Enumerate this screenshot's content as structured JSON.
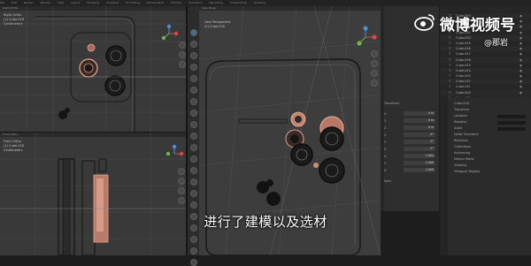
{
  "menubar": {
    "items": [
      "File",
      "Edit",
      "Render",
      "Window",
      "Help",
      "Layout",
      "Modeling",
      "Sculpting",
      "UV Editing",
      "Texture Paint",
      "Shading",
      "Animation",
      "Rendering",
      "Compositing",
      "Scripting"
    ]
  },
  "viewports": {
    "top_left": {
      "label": "Right Ortho",
      "info": [
        "Right Ortho",
        "(1) Cube.018",
        "Centimeters"
      ]
    },
    "bottom_left": {
      "label": "Front Ortho",
      "info": [
        "Front Ortho",
        "(1) Cube.018",
        "Centimeters"
      ]
    },
    "center": {
      "label": "User Persp",
      "info": [
        "User Perspective",
        "(1) Cube.018"
      ]
    }
  },
  "outliner": {
    "rows": [
      "Cube.054",
      "Cube.053",
      "Cube.052",
      "Cube.051",
      "Cube.050",
      "Cube.049",
      "Cube.048",
      "Cube.047",
      "Cube.046",
      "Cube.045",
      "Cube.044",
      "Cube.043",
      "Cube.042",
      "Cube.041",
      "Cube.040",
      "Cube.039"
    ]
  },
  "npanel": {
    "sections": [
      "Transform",
      "Item"
    ],
    "rows": [
      {
        "label": "X",
        "value": "0 m"
      },
      {
        "label": "Y",
        "value": "0 m"
      },
      {
        "label": "Z",
        "value": "0 m"
      },
      {
        "label": "X",
        "value": "0°"
      },
      {
        "label": "Y",
        "value": "0°"
      },
      {
        "label": "Z",
        "value": "0°"
      },
      {
        "label": "X",
        "value": "1.000"
      },
      {
        "label": "Y",
        "value": "1.000"
      },
      {
        "label": "Z",
        "value": "1.000"
      }
    ]
  },
  "properties": {
    "rows": [
      "Cube.018",
      "Transform",
      "Location",
      "Rotation",
      "Scale",
      "Delta Transform",
      "Relations",
      "Collections",
      "Instancing",
      "Motion Paths",
      "Visibility",
      "Viewport Display"
    ]
  },
  "subtitle": "进行了建模以及选材",
  "watermark": {
    "brand": "微博视频号",
    "user": "@那岩"
  }
}
